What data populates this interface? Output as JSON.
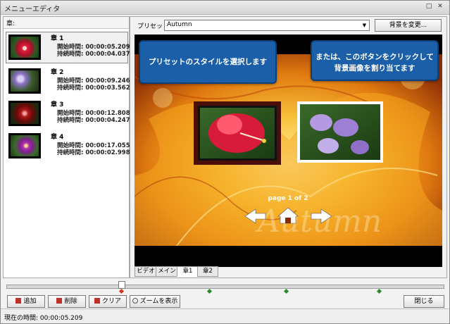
{
  "window": {
    "title": "メニューエディタ"
  },
  "left": {
    "header": "章:",
    "chapters": [
      {
        "title": "章 1",
        "start": "開始時間: 00:00:05.209",
        "duration": "持続時間: 00:00:04.037"
      },
      {
        "title": "章 2",
        "start": "開始時間: 00:00:09.246",
        "duration": "持続時間: 00:00:03.562"
      },
      {
        "title": "章 3",
        "start": "開始時間: 00:00:12.808",
        "duration": "持続時間: 00:00:04.247"
      },
      {
        "title": "章 4",
        "start": "開始時間: 00:00:17.055",
        "duration": "持続時間: 00:00:02.998"
      }
    ]
  },
  "preset": {
    "label": "プリセット",
    "value": "Autumn",
    "bg_button": "背景を変更..."
  },
  "canvas": {
    "page_indicator": "page 1 of 2",
    "watermark": "Autumn"
  },
  "callouts": {
    "preset": "プリセットのスタイルを選択します",
    "background": "または、このボタンをクリックして背景画像を割り当てます"
  },
  "tabs": [
    "ビデオ",
    "メイン",
    "章1",
    "章2"
  ],
  "buttons": {
    "add": "追加",
    "delete": "削除",
    "clear": "クリア",
    "zoom": "ズームを表示",
    "close": "閉じる"
  },
  "status": {
    "current_time": "現在の時間: 00:00:05.209"
  }
}
